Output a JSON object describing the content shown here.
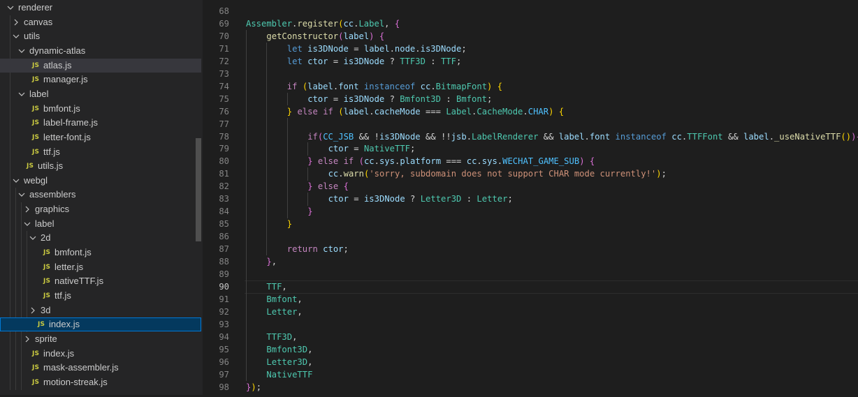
{
  "tree": [
    {
      "label": "renderer",
      "type": "folder",
      "open": true,
      "depth": 0
    },
    {
      "label": "canvas",
      "type": "folder",
      "open": false,
      "depth": 1
    },
    {
      "label": "utils",
      "type": "folder",
      "open": true,
      "depth": 1
    },
    {
      "label": "dynamic-atlas",
      "type": "folder",
      "open": true,
      "depth": 2
    },
    {
      "label": "atlas.js",
      "type": "file",
      "depth": 3,
      "state": "active"
    },
    {
      "label": "manager.js",
      "type": "file",
      "depth": 3
    },
    {
      "label": "label",
      "type": "folder",
      "open": true,
      "depth": 2
    },
    {
      "label": "bmfont.js",
      "type": "file",
      "depth": 3
    },
    {
      "label": "label-frame.js",
      "type": "file",
      "depth": 3
    },
    {
      "label": "letter-font.js",
      "type": "file",
      "depth": 3
    },
    {
      "label": "ttf.js",
      "type": "file",
      "depth": 3
    },
    {
      "label": "utils.js",
      "type": "file",
      "depth": 2
    },
    {
      "label": "webgl",
      "type": "folder",
      "open": true,
      "depth": 1
    },
    {
      "label": "assemblers",
      "type": "folder",
      "open": true,
      "depth": 2
    },
    {
      "label": "graphics",
      "type": "folder",
      "open": false,
      "depth": 3
    },
    {
      "label": "label",
      "type": "folder",
      "open": true,
      "depth": 3
    },
    {
      "label": "2d",
      "type": "folder",
      "open": true,
      "depth": 4
    },
    {
      "label": "bmfont.js",
      "type": "file",
      "depth": 5
    },
    {
      "label": "letter.js",
      "type": "file",
      "depth": 5
    },
    {
      "label": "nativeTTF.js",
      "type": "file",
      "depth": 5
    },
    {
      "label": "ttf.js",
      "type": "file",
      "depth": 5
    },
    {
      "label": "3d",
      "type": "folder",
      "open": false,
      "depth": 4
    },
    {
      "label": "index.js",
      "type": "file",
      "depth": 4,
      "state": "selected"
    },
    {
      "label": "sprite",
      "type": "folder",
      "open": false,
      "depth": 3
    },
    {
      "label": "index.js",
      "type": "file",
      "depth": 3
    },
    {
      "label": "mask-assembler.js",
      "type": "file",
      "depth": 3
    },
    {
      "label": "motion-streak.js",
      "type": "file",
      "depth": 3
    }
  ],
  "js_badge": "JS",
  "editor": {
    "current_line": 90,
    "lines": [
      {
        "n": 68,
        "indent": 0,
        "tokens": []
      },
      {
        "n": 69,
        "indent": 0,
        "tokens": [
          [
            "t",
            "Assembler"
          ],
          [
            "p",
            "."
          ],
          [
            "f",
            "register"
          ],
          [
            "y",
            "("
          ],
          [
            "v",
            "cc"
          ],
          [
            "p",
            "."
          ],
          [
            "t",
            "Label"
          ],
          [
            "p",
            ", "
          ],
          [
            "b",
            "{"
          ]
        ]
      },
      {
        "n": 70,
        "indent": 1,
        "tokens": [
          [
            "f",
            "getConstructor"
          ],
          [
            "b",
            "("
          ],
          [
            "v",
            "label"
          ],
          [
            "b",
            ")"
          ],
          [
            "p",
            " "
          ],
          [
            "b",
            "{"
          ]
        ]
      },
      {
        "n": 71,
        "indent": 2,
        "tokens": [
          [
            "k",
            "let"
          ],
          [
            "p",
            " "
          ],
          [
            "v",
            "is3DNode"
          ],
          [
            "p",
            " = "
          ],
          [
            "v",
            "label"
          ],
          [
            "p",
            "."
          ],
          [
            "v",
            "node"
          ],
          [
            "p",
            "."
          ],
          [
            "v",
            "is3DNode"
          ],
          [
            "p",
            ";"
          ]
        ]
      },
      {
        "n": 72,
        "indent": 2,
        "tokens": [
          [
            "k",
            "let"
          ],
          [
            "p",
            " "
          ],
          [
            "v",
            "ctor"
          ],
          [
            "p",
            " = "
          ],
          [
            "v",
            "is3DNode"
          ],
          [
            "p",
            " ? "
          ],
          [
            "t",
            "TTF3D"
          ],
          [
            "p",
            " : "
          ],
          [
            "t",
            "TTF"
          ],
          [
            "p",
            ";"
          ]
        ]
      },
      {
        "n": 73,
        "indent": 2,
        "tokens": []
      },
      {
        "n": 74,
        "indent": 2,
        "tokens": [
          [
            "c",
            "if"
          ],
          [
            "p",
            " "
          ],
          [
            "y",
            "("
          ],
          [
            "v",
            "label"
          ],
          [
            "p",
            "."
          ],
          [
            "v",
            "font"
          ],
          [
            "p",
            " "
          ],
          [
            "k",
            "instanceof"
          ],
          [
            "p",
            " "
          ],
          [
            "v",
            "cc"
          ],
          [
            "p",
            "."
          ],
          [
            "t",
            "BitmapFont"
          ],
          [
            "y",
            ")"
          ],
          [
            "p",
            " "
          ],
          [
            "y",
            "{"
          ]
        ]
      },
      {
        "n": 75,
        "indent": 3,
        "tokens": [
          [
            "v",
            "ctor"
          ],
          [
            "p",
            " = "
          ],
          [
            "v",
            "is3DNode"
          ],
          [
            "p",
            " ? "
          ],
          [
            "t",
            "Bmfont3D"
          ],
          [
            "p",
            " : "
          ],
          [
            "t",
            "Bmfont"
          ],
          [
            "p",
            ";"
          ]
        ]
      },
      {
        "n": 76,
        "indent": 2,
        "tokens": [
          [
            "y",
            "}"
          ],
          [
            "p",
            " "
          ],
          [
            "c",
            "else"
          ],
          [
            "p",
            " "
          ],
          [
            "c",
            "if"
          ],
          [
            "p",
            " "
          ],
          [
            "y",
            "("
          ],
          [
            "v",
            "label"
          ],
          [
            "p",
            "."
          ],
          [
            "v",
            "cacheMode"
          ],
          [
            "p",
            " === "
          ],
          [
            "t",
            "Label"
          ],
          [
            "p",
            "."
          ],
          [
            "t",
            "CacheMode"
          ],
          [
            "p",
            "."
          ],
          [
            "o",
            "CHAR"
          ],
          [
            "y",
            ")"
          ],
          [
            "p",
            " "
          ],
          [
            "y",
            "{"
          ]
        ]
      },
      {
        "n": 77,
        "indent": 3,
        "tokens": []
      },
      {
        "n": 78,
        "indent": 3,
        "tokens": [
          [
            "c",
            "if"
          ],
          [
            "b",
            "("
          ],
          [
            "o",
            "CC_JSB"
          ],
          [
            "p",
            " && !"
          ],
          [
            "v",
            "is3DNode"
          ],
          [
            "p",
            " && !!"
          ],
          [
            "v",
            "jsb"
          ],
          [
            "p",
            "."
          ],
          [
            "t",
            "LabelRenderer"
          ],
          [
            "p",
            " && "
          ],
          [
            "v",
            "label"
          ],
          [
            "p",
            "."
          ],
          [
            "v",
            "font"
          ],
          [
            "p",
            " "
          ],
          [
            "k",
            "instanceof"
          ],
          [
            "p",
            " "
          ],
          [
            "v",
            "cc"
          ],
          [
            "p",
            "."
          ],
          [
            "t",
            "TTFFont"
          ],
          [
            "p",
            " && "
          ],
          [
            "v",
            "label"
          ],
          [
            "p",
            "."
          ],
          [
            "f",
            "_useNativeTTF"
          ],
          [
            "y",
            "()"
          ],
          [
            "b",
            ")"
          ],
          [
            "b",
            "{"
          ]
        ]
      },
      {
        "n": 79,
        "indent": 4,
        "tokens": [
          [
            "v",
            "ctor"
          ],
          [
            "p",
            " = "
          ],
          [
            "t",
            "NativeTTF"
          ],
          [
            "p",
            ";"
          ]
        ]
      },
      {
        "n": 80,
        "indent": 3,
        "tokens": [
          [
            "b",
            "}"
          ],
          [
            "p",
            " "
          ],
          [
            "c",
            "else"
          ],
          [
            "p",
            " "
          ],
          [
            "c",
            "if"
          ],
          [
            "p",
            " "
          ],
          [
            "b",
            "("
          ],
          [
            "v",
            "cc"
          ],
          [
            "p",
            "."
          ],
          [
            "v",
            "sys"
          ],
          [
            "p",
            "."
          ],
          [
            "v",
            "platform"
          ],
          [
            "p",
            " === "
          ],
          [
            "v",
            "cc"
          ],
          [
            "p",
            "."
          ],
          [
            "v",
            "sys"
          ],
          [
            "p",
            "."
          ],
          [
            "o",
            "WECHAT_GAME_SUB"
          ],
          [
            "b",
            ")"
          ],
          [
            "p",
            " "
          ],
          [
            "b",
            "{"
          ]
        ]
      },
      {
        "n": 81,
        "indent": 4,
        "tokens": [
          [
            "v",
            "cc"
          ],
          [
            "p",
            "."
          ],
          [
            "f",
            "warn"
          ],
          [
            "y",
            "("
          ],
          [
            "s",
            "'sorry, subdomain does not support CHAR mode currently!'"
          ],
          [
            "y",
            ")"
          ],
          [
            "p",
            ";"
          ]
        ]
      },
      {
        "n": 82,
        "indent": 3,
        "tokens": [
          [
            "b",
            "}"
          ],
          [
            "p",
            " "
          ],
          [
            "c",
            "else"
          ],
          [
            "p",
            " "
          ],
          [
            "b",
            "{"
          ]
        ]
      },
      {
        "n": 83,
        "indent": 4,
        "tokens": [
          [
            "v",
            "ctor"
          ],
          [
            "p",
            " = "
          ],
          [
            "v",
            "is3DNode"
          ],
          [
            "p",
            " ? "
          ],
          [
            "t",
            "Letter3D"
          ],
          [
            "p",
            " : "
          ],
          [
            "t",
            "Letter"
          ],
          [
            "p",
            ";"
          ]
        ]
      },
      {
        "n": 84,
        "indent": 3,
        "tokens": [
          [
            "b",
            "}"
          ]
        ]
      },
      {
        "n": 85,
        "indent": 2,
        "tokens": [
          [
            "y",
            "}"
          ]
        ]
      },
      {
        "n": 86,
        "indent": 2,
        "tokens": []
      },
      {
        "n": 87,
        "indent": 2,
        "tokens": [
          [
            "c",
            "return"
          ],
          [
            "p",
            " "
          ],
          [
            "v",
            "ctor"
          ],
          [
            "p",
            ";"
          ]
        ]
      },
      {
        "n": 88,
        "indent": 1,
        "tokens": [
          [
            "b",
            "}"
          ],
          [
            "p",
            ","
          ]
        ]
      },
      {
        "n": 89,
        "indent": 1,
        "tokens": []
      },
      {
        "n": 90,
        "indent": 1,
        "tokens": [
          [
            "t",
            "TTF"
          ],
          [
            "p",
            ","
          ]
        ]
      },
      {
        "n": 91,
        "indent": 1,
        "tokens": [
          [
            "t",
            "Bmfont"
          ],
          [
            "p",
            ","
          ]
        ]
      },
      {
        "n": 92,
        "indent": 1,
        "tokens": [
          [
            "t",
            "Letter"
          ],
          [
            "p",
            ","
          ]
        ]
      },
      {
        "n": 93,
        "indent": 1,
        "tokens": []
      },
      {
        "n": 94,
        "indent": 1,
        "tokens": [
          [
            "t",
            "TTF3D"
          ],
          [
            "p",
            ","
          ]
        ]
      },
      {
        "n": 95,
        "indent": 1,
        "tokens": [
          [
            "t",
            "Bmfont3D"
          ],
          [
            "p",
            ","
          ]
        ]
      },
      {
        "n": 96,
        "indent": 1,
        "tokens": [
          [
            "t",
            "Letter3D"
          ],
          [
            "p",
            ","
          ]
        ]
      },
      {
        "n": 97,
        "indent": 1,
        "tokens": [
          [
            "t",
            "NativeTTF"
          ]
        ]
      },
      {
        "n": 98,
        "indent": 0,
        "tokens": [
          [
            "b",
            "}"
          ],
          [
            "y",
            ")"
          ],
          [
            "p",
            ";"
          ]
        ]
      }
    ]
  }
}
